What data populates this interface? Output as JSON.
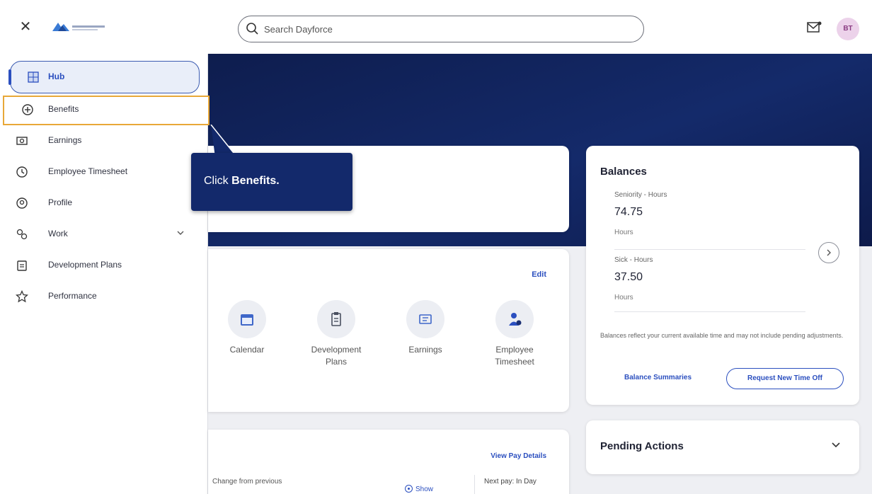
{
  "header": {
    "search_placeholder": "Search Dayforce",
    "avatar_initials": "BT"
  },
  "sidebar": {
    "items": [
      {
        "label": "Hub",
        "icon": "hub-icon",
        "active": true
      },
      {
        "label": "Benefits",
        "icon": "benefits-icon",
        "highlighted": true
      },
      {
        "label": "Earnings",
        "icon": "earnings-icon"
      },
      {
        "label": "Employee Timesheet",
        "icon": "timesheet-icon"
      },
      {
        "label": "Profile",
        "icon": "profile-icon"
      },
      {
        "label": "Work",
        "icon": "work-icon",
        "expandable": true
      },
      {
        "label": "Development Plans",
        "icon": "development-plans-icon"
      },
      {
        "label": "Performance",
        "icon": "star-icon"
      }
    ]
  },
  "callout": {
    "prefix": "Click ",
    "target": "Benefits."
  },
  "quick_links": {
    "edit_label": "Edit",
    "tiles": [
      {
        "label": "Calendar",
        "icon": "calendar-icon"
      },
      {
        "label": "Development Plans",
        "icon": "clipboard-icon"
      },
      {
        "label": "Earnings",
        "icon": "earnings-icon"
      },
      {
        "label": "Employee Timesheet",
        "icon": "person-clock-icon"
      }
    ]
  },
  "pay": {
    "view_label": "View Pay Details",
    "change_label": "Change from previous",
    "show_label": "Show",
    "next_pay_label": "Next pay: In Day"
  },
  "balances": {
    "title": "Balances",
    "items": [
      {
        "kind": "Seniority - Hours",
        "value": "74.75",
        "unit": "Hours"
      },
      {
        "kind": "Sick - Hours",
        "value": "37.50",
        "unit": "Hours"
      }
    ],
    "note": "Balances reflect your current available time and may not include pending adjustments.",
    "summaries_label": "Balance Summaries",
    "request_label": "Request New Time Off"
  },
  "pending": {
    "title": "Pending Actions"
  },
  "colors": {
    "brand_navy": "#13296b",
    "accent_blue": "#2b4fbf",
    "highlight_orange": "#e8a838"
  }
}
